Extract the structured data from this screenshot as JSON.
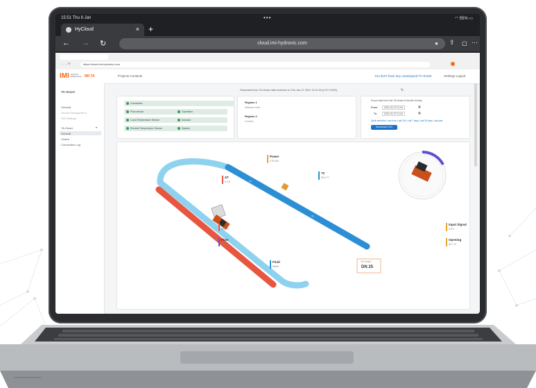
{
  "device_status": {
    "time": "15:51",
    "date": "Thu 6 Jan",
    "battery": "55%"
  },
  "browser": {
    "tab_title": "HyCloud",
    "new_tab": "+",
    "url": "cloud.imi-hydronic.com"
  },
  "inner_browser": {
    "url": "https://cloud.imi-hydronic.com"
  },
  "app_header": {
    "brand": "IMI",
    "brand_sub": "Hydronic Engineering",
    "product": "IMI TA",
    "projects": "Projects",
    "contacts": "Contacts",
    "notice": "You don't have any unassigned TA-Smart",
    "settings": "Settings",
    "logout": "Logout"
  },
  "sidebar": {
    "title": "TA-Smart",
    "items": [
      {
        "label": "General"
      },
      {
        "label": "Device Management"
      },
      {
        "label": "SW Settings"
      },
      {
        "label": "TA-Smart"
      },
      {
        "label": "General"
      },
      {
        "label": "Charts"
      },
      {
        "label": "Connection Log"
      }
    ]
  },
  "sync_status": "Generated from TA-Smart data received on Thu Jan 27 2021 12:21:00 (UTC+0200)",
  "status_chips": [
    {
      "label": "Connected"
    },
    {
      "label": "Flow sensor"
    },
    {
      "label": "Operation"
    },
    {
      "label": "Local Temperature Sensor"
    },
    {
      "label": "Actuator"
    },
    {
      "label": "Remote Temperature Sensor"
    },
    {
      "label": "System"
    }
  ],
  "regimes": {
    "r1_label": "Regime 1",
    "r1_value": "Setback mode",
    "r2_label": "Regime 2",
    "r2_value": "Comfort"
  },
  "export": {
    "title": "Export data from this TA-Smart to file (file format)",
    "from_label": "From",
    "from_value": "2021-01-27 21:34",
    "to_label": "To",
    "to_value": "2021-01-27 21:34",
    "quick": "Quick selection: Last hour, Last 24h, Last 7 days, Last 30 days, Last year",
    "download": "Download CSV"
  },
  "diagram": {
    "power_label": "Power",
    "power_value": "0.00 kW",
    "dt_label": "ΔT",
    "dt_value": "0.0 K",
    "t2_label": "T2",
    "t2_value": "56.8 °C",
    "t1_label": "T1",
    "t1_value": "56.8 °C",
    "flow_label": "Flow",
    "flow_value": "72.7 l/h",
    "fluid_label": "Fluid",
    "fluid_value": "Water",
    "size_label": "TA-Smart",
    "size_value": "DN 25",
    "input_label": "Input Signal",
    "input_value": "5.8 V",
    "opening_label": "Opening",
    "opening_value": "82.1 %"
  },
  "colors": {
    "accent": "#ff6a13",
    "link": "#1a73c9",
    "hot": "#e8563f",
    "cold": "#2c8fd6",
    "ok": "#3a9a56"
  }
}
